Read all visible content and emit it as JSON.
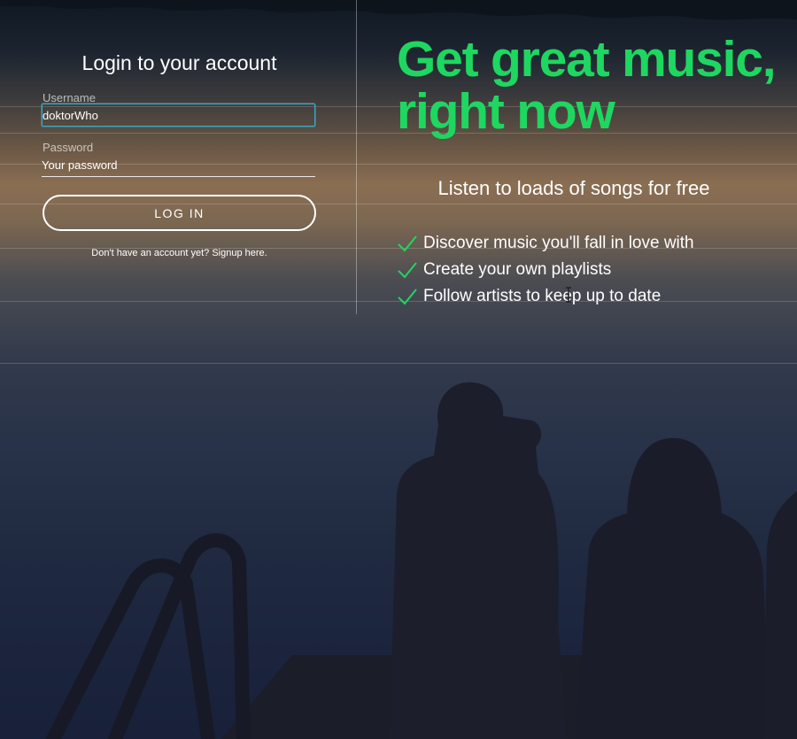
{
  "login": {
    "title": "Login to your account",
    "username_label": "Username",
    "username_value": "doktorWho",
    "password_label": "Password",
    "password_placeholder": "Your password",
    "login_button": "LOG IN",
    "signup_text": "Don't have an account yet? Signup here."
  },
  "promo": {
    "headline_line1": "Get great music,",
    "headline_line2": "right now",
    "subheadline": "Listen to loads of songs for free",
    "features": [
      "Discover music you'll fall in love with",
      "Create your own playlists",
      "Follow artists to keep up to date"
    ]
  },
  "icons": {
    "check": "check-icon",
    "cursor": "text-cursor-icon"
  },
  "colors": {
    "accent": "#1ed760",
    "focus_border": "#3ca9c4",
    "text": "#ffffff"
  }
}
